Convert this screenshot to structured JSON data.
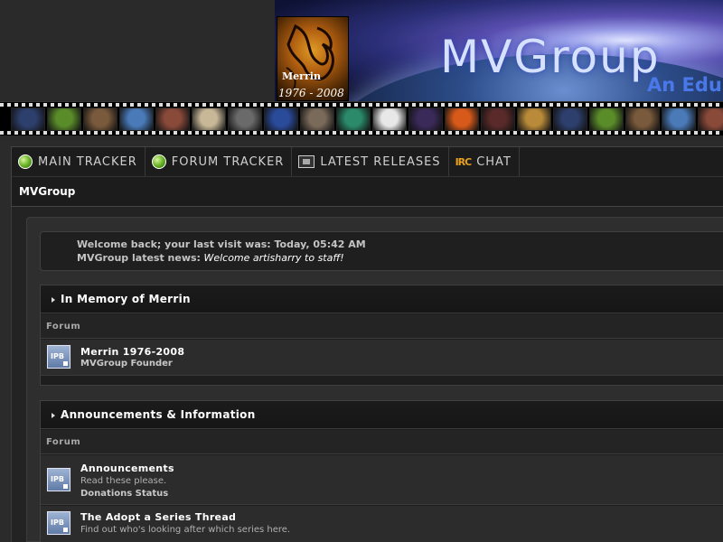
{
  "banner": {
    "memorial_name": "Merrin",
    "memorial_dates": "1976 - 2008",
    "site_logo": "MVGroup",
    "tagline": "An Edu",
    "film_strip_icons": [
      "lightning-icon",
      "frog-icon",
      "portrait-icon",
      "dolphin-icon",
      "woman-portrait-icon",
      "dinosaur-skeleton-icon",
      "bearded-man-icon",
      "earth-icon",
      "presenter-icon",
      "dna-icon",
      "panda-icon",
      "galaxy-icon",
      "explosion-icon",
      "tree-icon",
      "statue-icon",
      "lightning-icon",
      "frog-icon",
      "portrait-icon",
      "dolphin-icon",
      "woman-portrait-icon"
    ],
    "film_strip_colors": [
      "#2d3f6c",
      "#5a8c2a",
      "#7a5a3c",
      "#4a7ab8",
      "#8a4a3a",
      "#c8b898",
      "#6a6a6a",
      "#2a4a9a",
      "#7a6a5a",
      "#2a8a6a",
      "#e8e8e8",
      "#3a2a5a",
      "#d85a1a",
      "#5a2a2a",
      "#b88a3a",
      "#2d3f6c",
      "#5a8c2a",
      "#7a5a3c",
      "#4a7ab8",
      "#8a4a3a"
    ]
  },
  "nav": {
    "tabs": [
      {
        "label": "MAIN TRACKER",
        "icon": "green-orb-icon"
      },
      {
        "label": "FORUM TRACKER",
        "icon": "green-orb-icon"
      },
      {
        "label": "LATEST RELEASES",
        "icon": "film-icon"
      },
      {
        "label": "CHAT",
        "icon": "irc-icon"
      }
    ],
    "irc_icon_text": "IRC"
  },
  "breadcrumb": "MVGroup",
  "welcome": {
    "last_visit": "Welcome back; your last visit was: Today, 05:42 AM",
    "news_label": "MVGroup latest news:",
    "news_text": "Welcome artisharry to staff!"
  },
  "categories": [
    {
      "title": "In Memory of Merrin",
      "column_header": "Forum",
      "forums": [
        {
          "name": "Merrin 1976-2008",
          "description": "",
          "subforum": "MVGroup Founder"
        }
      ]
    },
    {
      "title": "Announcements & Information",
      "column_header": "Forum",
      "forums": [
        {
          "name": "Announcements",
          "description": "Read these please.",
          "subforum": "Donations Status"
        },
        {
          "name": "The Adopt a Series Thread",
          "description": "Find out who's looking after which series here.",
          "subforum": ""
        }
      ]
    }
  ],
  "forum_icon_text": "IPB",
  "colors": {
    "background": "#2b2b2b",
    "panel": "#1e1e1e",
    "text_bright": "#ffffff",
    "text_muted": "#b0b0b0",
    "logo": "#d6e0ff",
    "tagline": "#4a78e8"
  }
}
